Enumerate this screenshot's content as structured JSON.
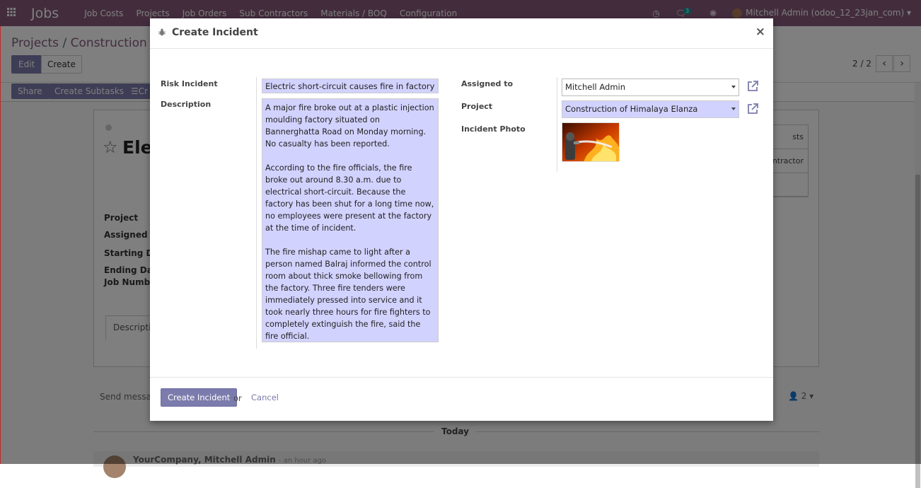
{
  "navbar": {
    "brand": "Jobs",
    "menu": [
      "Job Costs",
      "Projects",
      "Job Orders",
      "Sub Contractors",
      "Materials / BOQ",
      "Configuration"
    ],
    "message_count": "3",
    "user": "Mitchell Admin (odoo_12_23jan_com)"
  },
  "control_panel": {
    "breadcrumb_root": "Projects",
    "breadcrumb_current": "Construction of H",
    "edit_label": "Edit",
    "create_label": "Create",
    "pager": "2 / 2"
  },
  "statusbar": {
    "share_label": "Share",
    "subtasks_label": "Create Subtasks",
    "more_label": "Cr"
  },
  "sheet": {
    "title": "Elec",
    "labels": [
      "Project",
      "Assigned to",
      "Starting Dat",
      "Ending Date",
      "Job Numbe"
    ],
    "tab": "Descriptio",
    "right_cells": [
      "sts",
      "ntractor",
      ""
    ]
  },
  "chatter": {
    "send_message": "Send messag",
    "followers": "2",
    "today": "Today",
    "author": "YourCompany, Mitchell Admin",
    "date": "- an hour ago"
  },
  "modal": {
    "title": "Create Incident",
    "risk_incident_label": "Risk Incident",
    "risk_incident_value": "Electric short-circuit causes fire in factory",
    "description_label": "Description",
    "description_paragraphs": [
      "A major fire broke out at a plastic injection moulding factory situated on Bannerghatta Road on Monday morning. No casualty has been reported.",
      "According to the fire officials, the fire broke out around 8.30 a.m. due to electrical short-circuit. Because the factory has been shut for a long time now, no employees were present at the factory at the time of incident.",
      "The fire mishap came to light after a person named Balraj informed the control room about thick smoke bellowing from the factory. Three fire tenders were immediately pressed into service and it took nearly three hours for fire fighters to completely extinguish the fire, said the fire official."
    ],
    "assigned_to_label": "Assigned to",
    "assigned_to_value": "Mitchell Admin",
    "project_label": "Project",
    "project_value": "Construction of Himalaya Elanza",
    "incident_photo_label": "Incident Photo",
    "create_button": "Create Incident",
    "or_text": "or",
    "cancel_label": "Cancel"
  },
  "colors": {
    "navbar": "#875a7b",
    "primary": "#7c7bad",
    "required_field": "#d2d2ff"
  }
}
